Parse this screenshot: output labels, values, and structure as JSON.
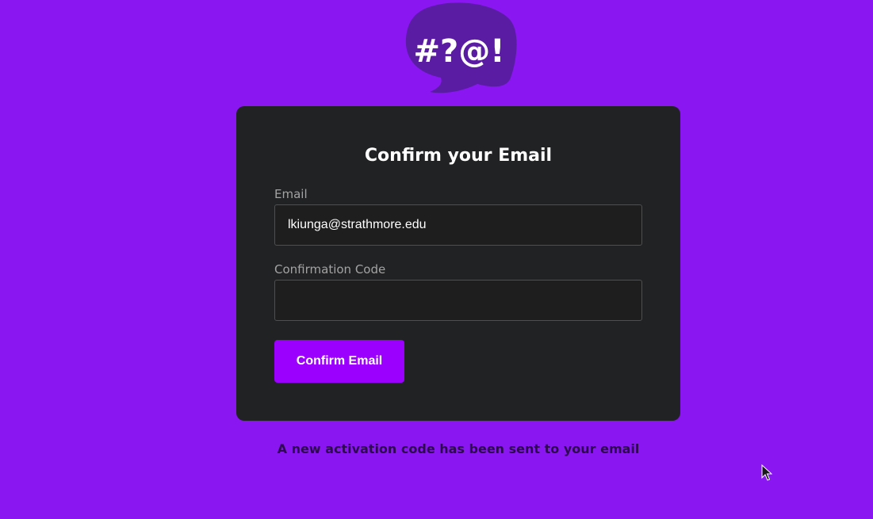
{
  "logo": {
    "text": "#?@!",
    "bubble_color": "#5a1ca3"
  },
  "card": {
    "title": "Confirm your Email",
    "email": {
      "label": "Email",
      "value": "lkiunga@strathmore.edu",
      "placeholder": ""
    },
    "code": {
      "label": "Confirmation Code",
      "value": "",
      "placeholder": ""
    },
    "submit_label": "Confirm Email"
  },
  "notice": "A new activation code has been sent to your email",
  "colors": {
    "page_background": "#8a17f2",
    "card_background": "#212224",
    "accent_button": "#9b00ff",
    "notice_text": "#2e0a4e"
  }
}
